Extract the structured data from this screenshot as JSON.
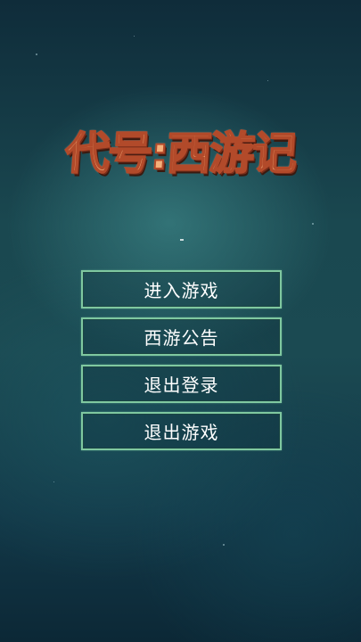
{
  "game": {
    "title": "代号:西游记"
  },
  "menu": {
    "items": [
      {
        "label": "进入游戏"
      },
      {
        "label": "西游公告"
      },
      {
        "label": "退出登录"
      },
      {
        "label": "退出游戏"
      }
    ]
  },
  "colors": {
    "title_fill": "#f6b07a",
    "title_outline": "#b24a2a",
    "button_border": "#7fc8a0",
    "background": "#1a4850"
  }
}
